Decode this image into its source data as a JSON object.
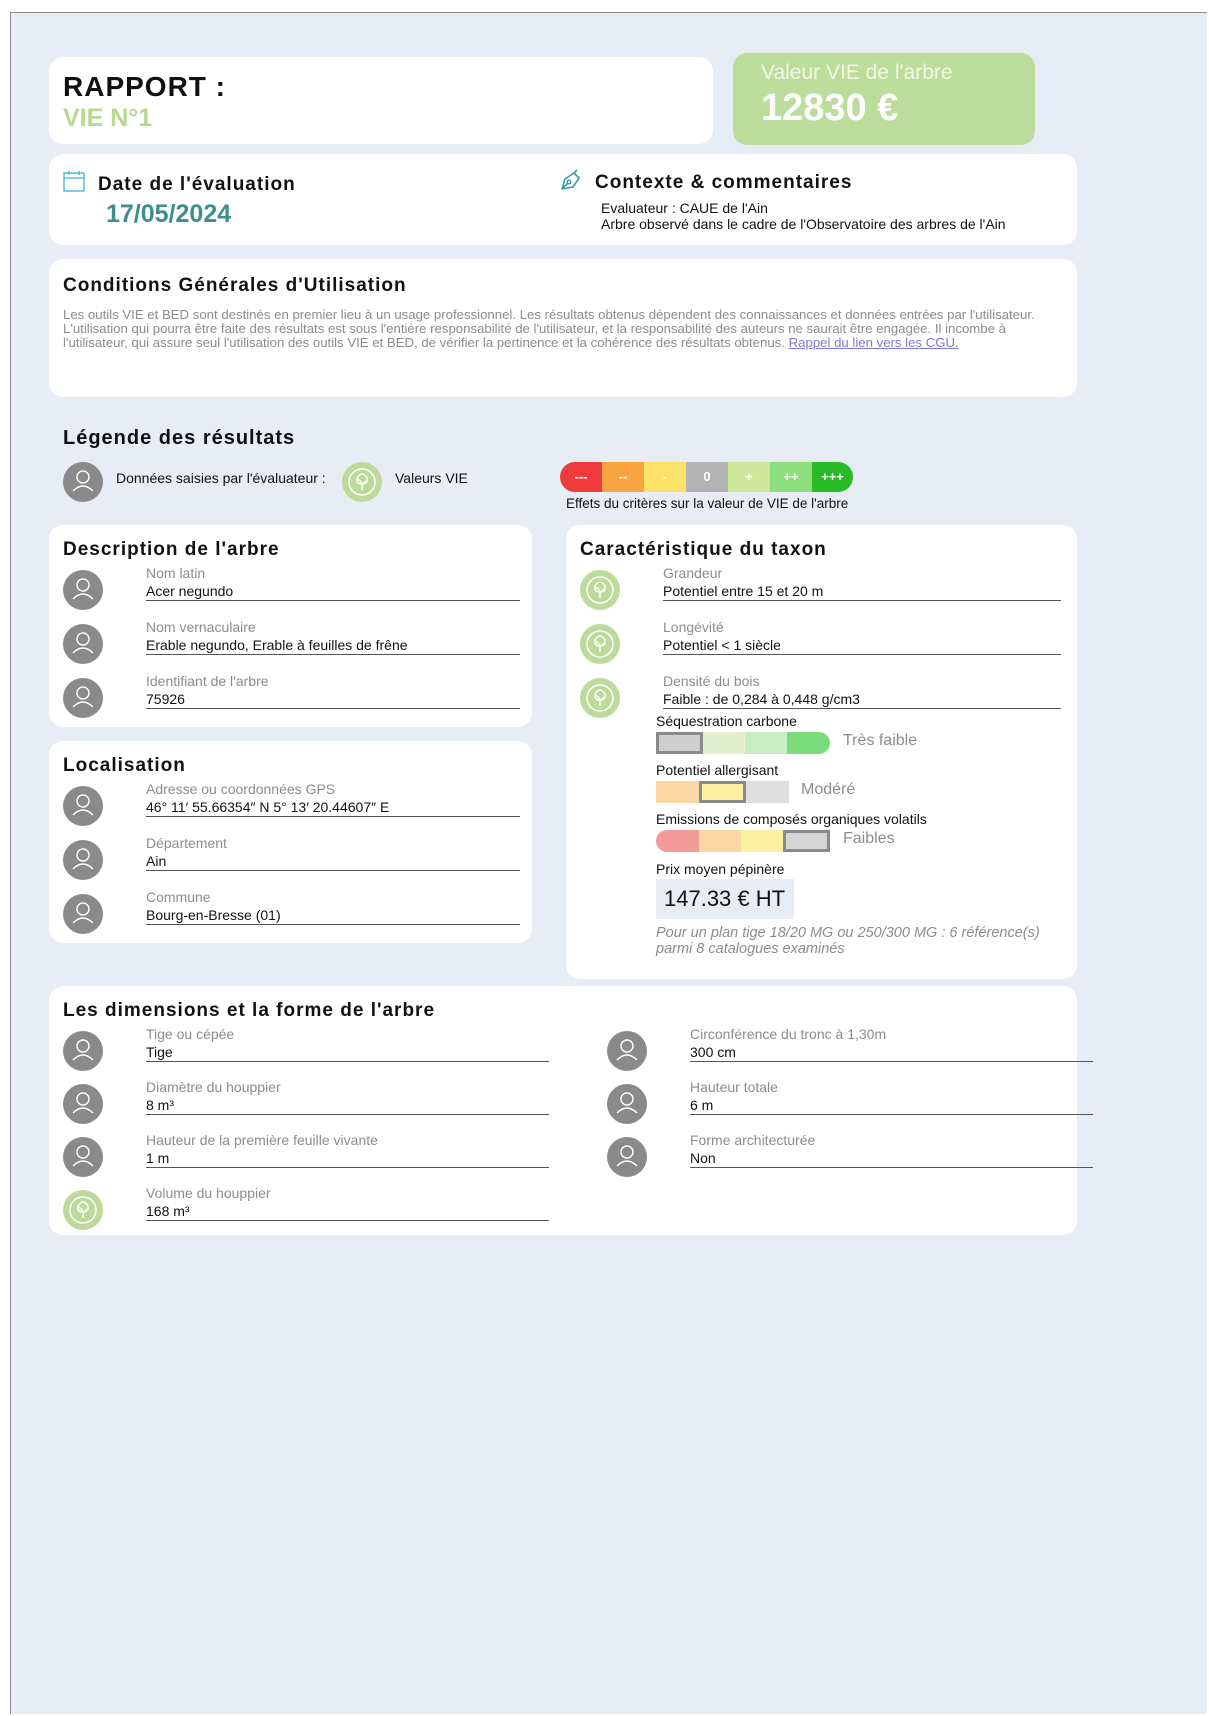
{
  "header": {
    "title": "RAPPORT :",
    "subtitle": "VIE N°1",
    "value_label": "Valeur VIE de l'arbre",
    "value": "12830 €"
  },
  "evaluation": {
    "date_label": "Date de l'évaluation",
    "date": "17/05/2024",
    "context_label": "Contexte & commentaires",
    "evaluator": "Evaluateur : CAUE de l'Ain",
    "comment": "Arbre observé dans le cadre de l'Observatoire des arbres de l'Ain"
  },
  "cgu": {
    "title": "Conditions Générales d'Utilisation",
    "text": "Les outils VIE et BED sont destinés en premier lieu à un usage professionnel. Les résultats obtenus dépendent des connaissances et données entrées par l'utilisateur. L'utilisation qui pourra être faite des résultats est sous l'entière responsabilité de l'utilisateur, et la responsabilité des auteurs ne saurait être engagée. Il incombe à l'utilisateur, qui assure seul l'utilisation des outils VIE et BED, de vérifier la pertinence et la cohérence des résultats obtenus.",
    "link_text": "Rappel du lien vers les CGU."
  },
  "legend": {
    "title": "Légende des résultats",
    "evaluator_data": "Données saisies par l'évaluateur :",
    "vie_values": "Valeurs VIE",
    "scale": [
      {
        "label": "---",
        "color": "#ee3b3b"
      },
      {
        "label": "--",
        "color": "#f7a33f"
      },
      {
        "label": "-",
        "color": "#fbe36a"
      },
      {
        "label": "0",
        "color": "#b3b3b3"
      },
      {
        "label": "+",
        "color": "#cfe79a"
      },
      {
        "label": "++",
        "color": "#8ee07f"
      },
      {
        "label": "+++",
        "color": "#27bb27"
      }
    ],
    "scale_caption": "Effets du critères sur la valeur de VIE de l'arbre"
  },
  "description": {
    "title": "Description de l'arbre",
    "fields": [
      {
        "label": "Nom latin",
        "value": "Acer negundo"
      },
      {
        "label": "Nom vernaculaire",
        "value": "Erable negundo, Erable à feuilles de frêne"
      },
      {
        "label": "Identifiant de l'arbre",
        "value": "75926"
      }
    ]
  },
  "location": {
    "title": "Localisation",
    "fields": [
      {
        "label": "Adresse ou coordonnées GPS",
        "value": "46° 11′ 55.66354″ N 5° 13′ 20.44607″ E"
      },
      {
        "label": "Département",
        "value": "Ain"
      },
      {
        "label": "Commune",
        "value": "Bourg-en-Bresse (01)"
      }
    ]
  },
  "taxon": {
    "title": "Caractéristique du taxon",
    "fields": [
      {
        "label": "Grandeur",
        "value": "Potentiel entre 15 et 20 m"
      },
      {
        "label": "Longévité",
        "value": "Potentiel < 1 siècle"
      },
      {
        "label": "Densité du bois",
        "value": "Faible : de 0,284 à 0,448 g/cm3"
      }
    ],
    "carbon": {
      "label": "Séquestration carbone",
      "value": "Très faible",
      "level": 1,
      "of": 4
    },
    "allergen": {
      "label": "Potentiel allergisant",
      "value": "Modéré",
      "level": 2,
      "of": 3
    },
    "voc": {
      "label": "Emissions de composés organiques volatils",
      "value": "Faibles",
      "level": 4,
      "of": 4
    },
    "price_label": "Prix moyen pépinère",
    "price": "147.33 € HT",
    "price_note": "Pour un plan tige 18/20 MG ou 250/300 MG : 6 référence(s) parmi 8 catalogues examinés"
  },
  "dimensions": {
    "title": "Les dimensions et la forme de l'arbre",
    "left": [
      {
        "label": "Tige ou cépée",
        "value": "Tige"
      },
      {
        "label": "Diamètre du houppier",
        "value": "8 m³"
      },
      {
        "label": "Hauteur de la première feuille vivante",
        "value": "1 m"
      },
      {
        "label": "Volume du houppier",
        "value": "168 m³"
      }
    ],
    "right": [
      {
        "label": "Circonférence du tronc à 1,30m",
        "value": "300 cm"
      },
      {
        "label": "Hauteur totale",
        "value": "6 m"
      },
      {
        "label": "Forme architecturée",
        "value": "Non"
      }
    ]
  }
}
